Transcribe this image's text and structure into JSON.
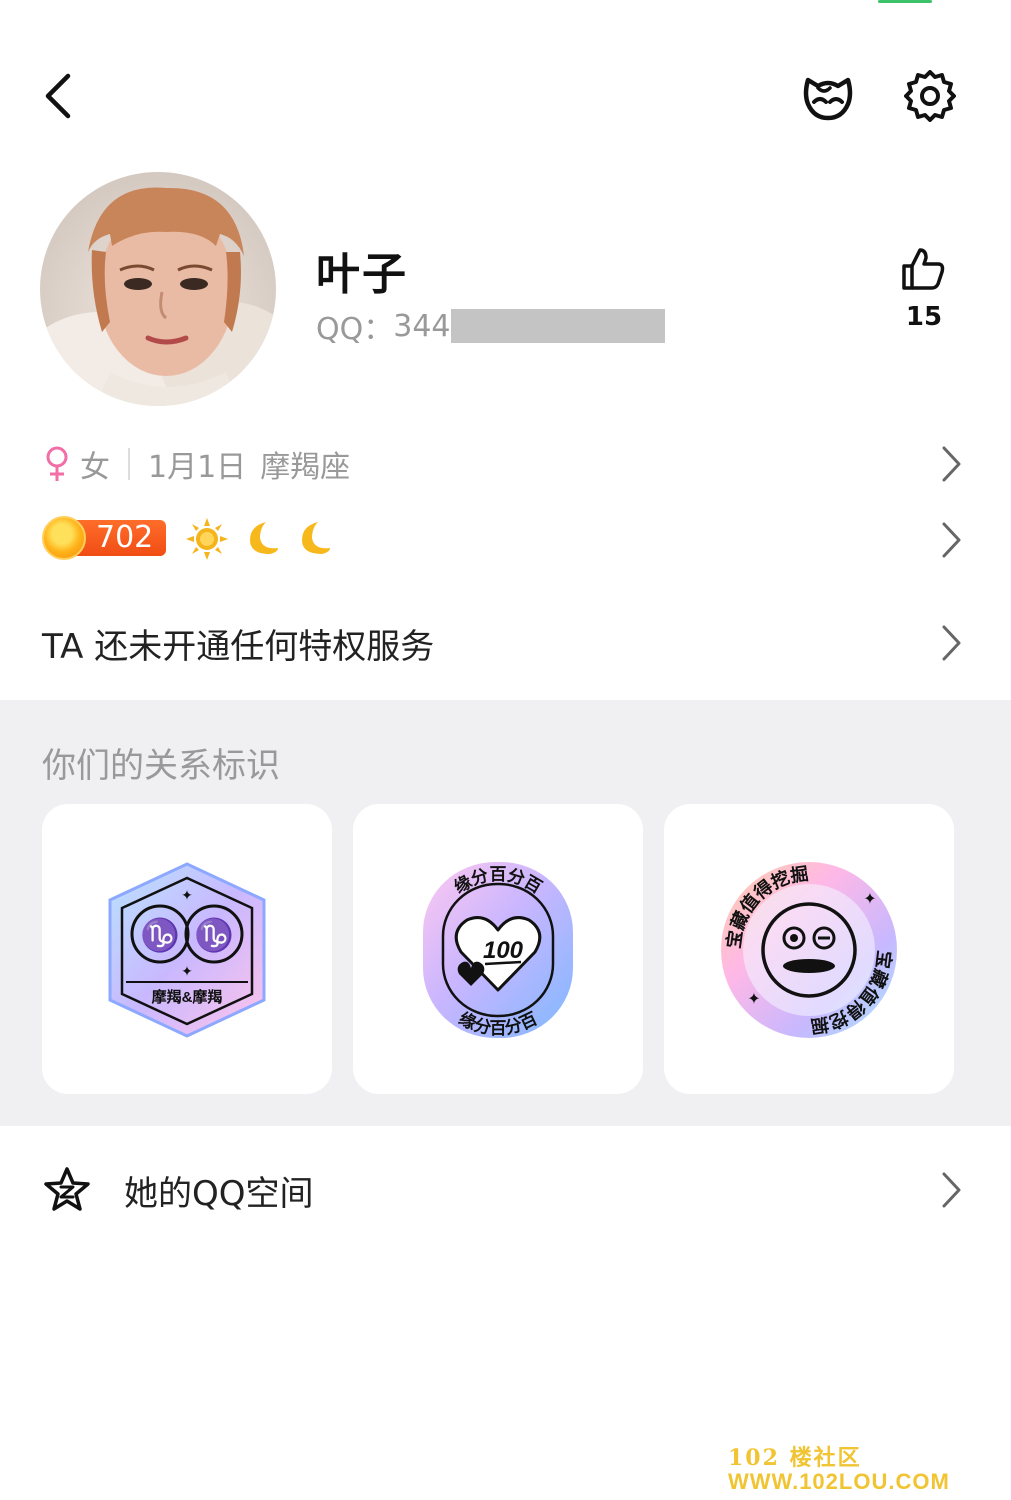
{
  "profile": {
    "name": "叶子",
    "qq_label": "QQ：",
    "qq_visible_prefix": "344",
    "likes": "15"
  },
  "info": {
    "gender": "女",
    "birthday": "1月1日",
    "zodiac": "摩羯座"
  },
  "level": {
    "value": "702"
  },
  "privilege": {
    "text": "TA 还未开通任何特权服务"
  },
  "relationship": {
    "title": "你们的关系标识",
    "badges": [
      {
        "label": "摩羯&摩羯"
      },
      {
        "label": "缘分百分百",
        "center": "100"
      },
      {
        "label": "宝藏值得挖掘"
      }
    ]
  },
  "space": {
    "label": "她的QQ空间"
  },
  "watermark": {
    "line1": "102 楼社区",
    "line2": "WWW.102LOU.COM"
  },
  "colors": {
    "female": "#f26ea6",
    "level_bar": "#f04d14",
    "section_bg": "#f0f0f2"
  }
}
